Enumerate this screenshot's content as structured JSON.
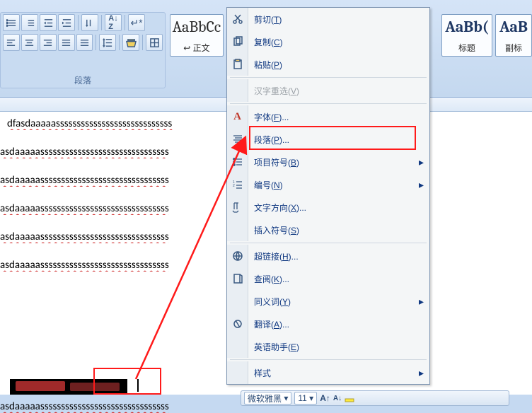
{
  "ribbon": {
    "para_group_label": "段落",
    "styles": [
      {
        "aa": "AaBbCc",
        "name": "↩ 正文",
        "cls": "big"
      },
      {
        "aa": "AaBb(",
        "name": "标题",
        "cls": "mid"
      },
      {
        "aa": "AaB",
        "name": "副标",
        "cls": "mid"
      }
    ]
  },
  "context_menu": {
    "items": [
      {
        "icon": "cut",
        "label": "剪切",
        "key": "T",
        "interact": true
      },
      {
        "icon": "copy",
        "label": "复制",
        "key": "C",
        "interact": true
      },
      {
        "icon": "paste",
        "label": "粘贴",
        "key": "P",
        "interact": true
      },
      {
        "div": true
      },
      {
        "icon": "",
        "label": "汉字重选",
        "key": "V",
        "interact": false,
        "disabled": true
      },
      {
        "div": true
      },
      {
        "icon": "font",
        "label": "字体",
        "key": "F",
        "ell": true,
        "interact": true
      },
      {
        "icon": "para",
        "label": "段落",
        "key": "P",
        "ell": true,
        "interact": true,
        "hl": true
      },
      {
        "icon": "bullets",
        "label": "项目符号",
        "key": "B",
        "sub": true,
        "interact": true
      },
      {
        "icon": "numbers",
        "label": "编号",
        "key": "N",
        "sub": true,
        "interact": true
      },
      {
        "icon": "textdir",
        "label": "文字方向",
        "key": "X",
        "ell": true,
        "interact": true
      },
      {
        "icon": "",
        "label": "插入符号",
        "key": "S",
        "interact": true
      },
      {
        "div": true
      },
      {
        "icon": "link",
        "label": "超链接",
        "key": "H",
        "ell": true,
        "interact": true
      },
      {
        "icon": "lookup",
        "label": "查阅",
        "key": "K",
        "ell": true,
        "interact": true
      },
      {
        "icon": "",
        "label": "同义词",
        "key": "Y",
        "sub": true,
        "interact": true
      },
      {
        "icon": "translate",
        "label": "翻译",
        "key": "A",
        "ell": true,
        "interact": true
      },
      {
        "icon": "",
        "label": "英语助手",
        "key": "E",
        "interact": true
      },
      {
        "div": true
      },
      {
        "icon": "",
        "label": "样式",
        "key": "",
        "sub": true,
        "interact": true
      }
    ]
  },
  "doc": {
    "line1": "dfasdaaaaassssssssssssssssssssssssssss",
    "line2": "asdaaaaasssssssssssssssssssssssssssssss",
    "repeat_count": 5,
    "last_partial": "asdaaaaasssssssssssssssssssssssssssssss"
  },
  "mini_toolbar": {
    "font": "微软雅黑",
    "size": "11"
  }
}
